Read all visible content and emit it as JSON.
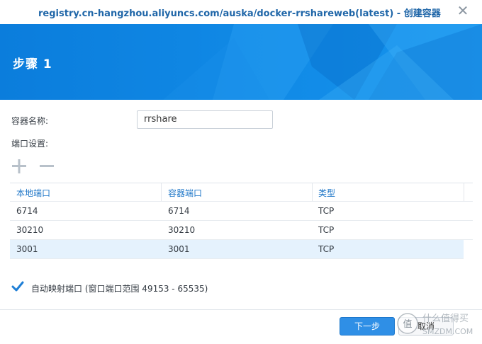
{
  "window": {
    "title": "registry.cn-hangzhou.aliyuncs.com/auska/docker-rrshareweb(latest) - 创建容器",
    "close_icon": "close-icon"
  },
  "banner": {
    "step_title": "步骤 1",
    "color": "#0a86e6"
  },
  "form": {
    "container_name_label": "容器名称:",
    "container_name_value": "rrshare",
    "port_settings_label": "端口设置:"
  },
  "toolbar": {
    "add_icon": "plus-icon",
    "remove_icon": "minus-icon"
  },
  "ports_table": {
    "headers": [
      "本地端口",
      "容器端口",
      "类型"
    ],
    "rows": [
      {
        "local": "6714",
        "container": "6714",
        "type": "TCP"
      },
      {
        "local": "30210",
        "container": "30210",
        "type": "TCP"
      },
      {
        "local": "3001",
        "container": "3001",
        "type": "TCP",
        "selected": true
      }
    ]
  },
  "auto_map": {
    "checked": true,
    "label": "自动映射端口 (窗口端口范围 49153 - 65535)"
  },
  "footer": {
    "next_label": "下一步",
    "cancel_label": "取消"
  },
  "watermark": {
    "text_cn": "什么值得买",
    "text_en": "SMZDM.COM",
    "logo_char": "值"
  }
}
